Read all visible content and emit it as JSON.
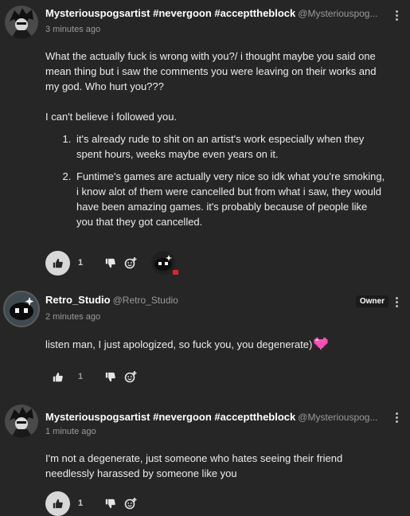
{
  "comments": [
    {
      "username": "Mysteriouspogsartist #nevergoon #accepttheblock",
      "handle": "@Mysteriouspog...",
      "time": "3 minutes ago",
      "paragraphs": [
        "What the actually fuck is wrong with you?/ i thought maybe you said one mean thing but i saw the comments you were leaving on their works and my god. Who hurt you???",
        "I can't believe i followed you."
      ],
      "list": [
        "it's already rude to shit on an artist's work especially when they spent hours, weeks maybe even years on it.",
        "Funtime's games are actually very nice so idk what you're smoking, i know alot of them were cancelled but from what i saw, they would have been amazing games. it's  probably because of people like you that they got cancelled."
      ],
      "like_count": "1"
    },
    {
      "username": "Retro_Studio",
      "handle": "@Retro_Studio",
      "badge": "Owner",
      "time": "2 minutes ago",
      "text": "listen man, I just apologized, so fuck you, you degenerate)",
      "like_count": "1"
    },
    {
      "username": "Mysteriouspogsartist #nevergoon #accepttheblock",
      "handle": "@Mysteriouspog...",
      "time": "1 minute ago",
      "text": "I'm not a degenerate, just someone who hates seeing their friend needlessly harassed by someone like you",
      "like_count": "1"
    }
  ],
  "icons": {
    "like": "thumbs-up-icon",
    "dislike": "thumbs-down-icon",
    "add_reaction": "add-reaction-icon",
    "more": "kebab-menu-icon",
    "heart": "pixel-heart-icon"
  },
  "colors": {
    "background": "#262626",
    "text": "#e6e6e6",
    "muted": "#9a9a9a",
    "heart": "#ff4fb3",
    "badge_bg": "#1b1b1b"
  }
}
